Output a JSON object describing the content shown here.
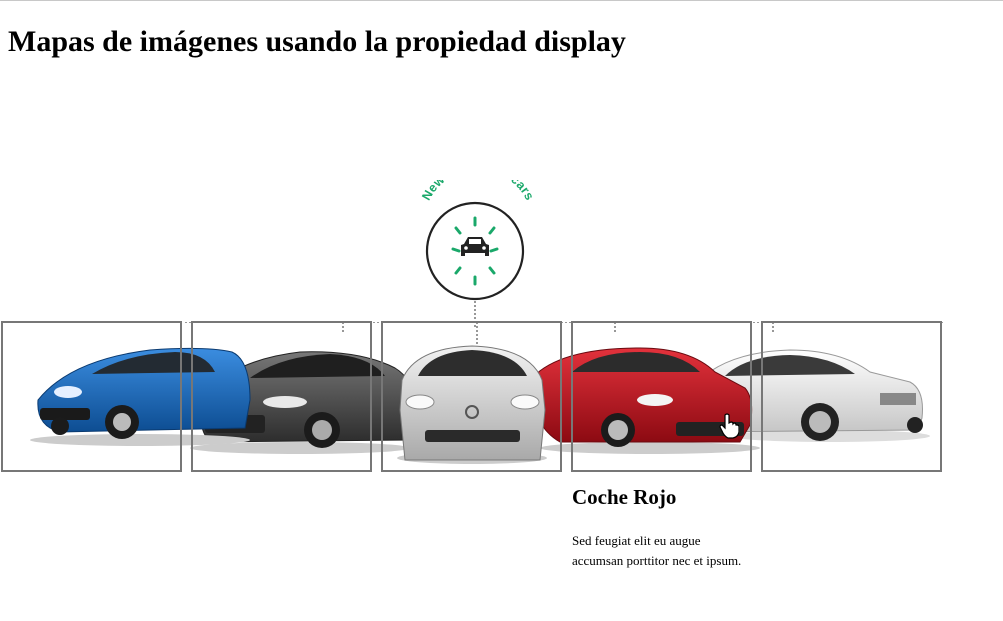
{
  "page": {
    "heading": "Mapas de imágenes usando la propiedad display"
  },
  "badge": {
    "text": "Newer, cleaner cars",
    "icon": "car-icon",
    "ring_color": "#222222",
    "accent_color": "#1aa86a"
  },
  "cars": [
    {
      "name": "blue-hatchback",
      "color": "#1b64b4"
    },
    {
      "name": "dark-gray-sedan",
      "color": "#4a4a4a"
    },
    {
      "name": "silver-hybrid",
      "color": "#c9c9c9"
    },
    {
      "name": "red-sedan",
      "color": "#b3101a"
    },
    {
      "name": "white-sedan",
      "color": "#dcdcdc"
    }
  ],
  "tooltip": {
    "title": "Coche Rojo",
    "text": "Sed feugiat elit eu augue accumsan porttitor nec et ipsum."
  }
}
